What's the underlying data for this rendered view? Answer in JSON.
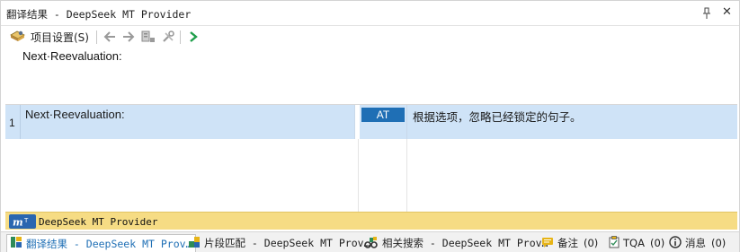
{
  "window": {
    "title": "翻译结果 - DeepSeek MT Provider"
  },
  "toolbar": {
    "settings_label": "项目设置(S)"
  },
  "source_preview": {
    "text": "Next·Reevaluation:"
  },
  "results": {
    "rows": [
      {
        "number": "1",
        "source": "Next·Reevaluation:",
        "origin_badge": "AT",
        "target": "根据选项，忽略已经锁定的句子。"
      }
    ]
  },
  "provider": {
    "name": "DeepSeek MT Provider"
  },
  "tabs": [
    {
      "label": "翻译结果 - DeepSeek MT Prov…",
      "active": true,
      "icon": "translation-results-icon"
    },
    {
      "label": "片段匹配 - DeepSeek MT Prov…",
      "active": false,
      "icon": "fragment-match-icon"
    },
    {
      "label": "相关搜索 - DeepSeek MT Prov…",
      "active": false,
      "icon": "concordance-search-icon"
    },
    {
      "label": "备注",
      "count": "(0)",
      "active": false,
      "icon": "comments-icon"
    },
    {
      "label": "TQA",
      "count": "(0)",
      "active": false,
      "icon": "tqa-icon"
    },
    {
      "label": "消息",
      "count": "(0)",
      "active": false,
      "icon": "messages-icon"
    }
  ],
  "colors": {
    "selection": "#cfe3f7",
    "badge": "#1f6fb5",
    "provider_strip": "#f6dc84",
    "next_arrow": "#1e9e4a"
  }
}
